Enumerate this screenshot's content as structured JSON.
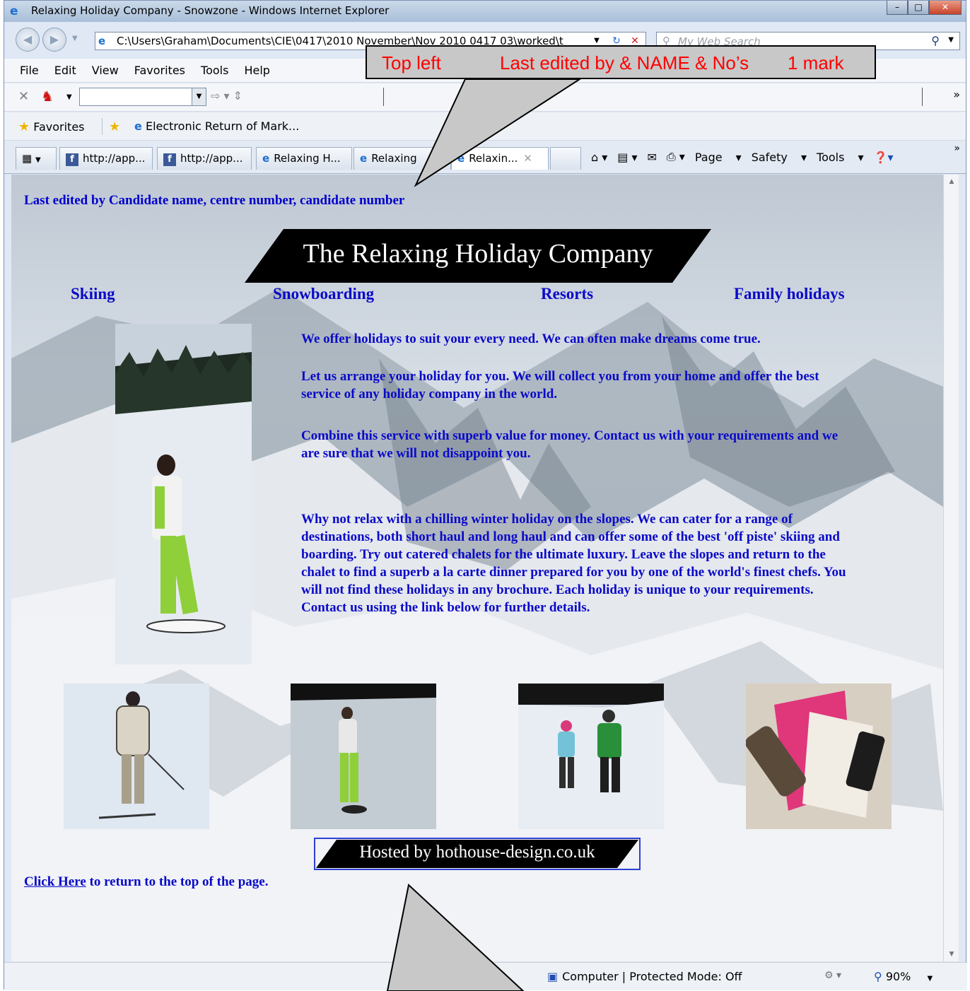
{
  "window": {
    "title": "Relaxing Holiday Company - Snowzone - Windows Internet Explorer",
    "address": "C:\\Users\\Graham\\Documents\\CIE\\0417\\2010 November\\Nov 2010 0417 03\\worked\\t",
    "search_placeholder": "My Web Search"
  },
  "menu": [
    "File",
    "Edit",
    "View",
    "Favorites",
    "Tools",
    "Help"
  ],
  "favorites": {
    "label": "Favorites",
    "item": "Electronic Return of Mark..."
  },
  "tabs": [
    {
      "label": "http://app...",
      "icon": "facebook-icon"
    },
    {
      "label": "http://app...",
      "icon": "facebook-icon"
    },
    {
      "label": "Relaxing H...",
      "icon": "ie-icon"
    },
    {
      "label": "Relaxing",
      "icon": "ie-icon"
    },
    {
      "label": "Relaxin...",
      "icon": "ie-icon"
    }
  ],
  "commands": {
    "page": "Page",
    "safety": "Safety",
    "tools": "Tools"
  },
  "page": {
    "edited": "Last edited by Candidate name, centre number, candidate number",
    "title": "The Relaxing Holiday Company",
    "nav": [
      "Skiing",
      "Snowboarding",
      "Resorts",
      "Family holidays"
    ],
    "paragraphs": [
      "We offer holidays to suit your every need. We can often make dreams come true.",
      "Let us arrange your holiday for you. We will collect you from your home and offer the best service of any holiday company in the world.",
      "Combine this service with superb value for money. Contact us with your requirements and we are sure that we will not disappoint you.",
      "Why not relax with a chilling winter holiday on the slopes. We can cater for a range of destinations, both short haul and long haul and can offer some of the best 'off piste' skiing and boarding. Try out catered chalets for the ultimate luxury. Leave the slopes and return to the chalet to find a superb a la carte dinner prepared for you by one of the world's finest chefs. You will not find these holidays in any brochure. Each holiday is unique to your requirements. Contact us using the link below for further details."
    ],
    "hosted": "Hosted by hothouse-design.co.uk",
    "click_here": "Click Here",
    "return_text": " to return to the top of the page."
  },
  "status": {
    "zone": "Computer | Protected Mode: Off",
    "zoom": "90%"
  },
  "annotation": {
    "pos": "Top left",
    "what": "Last edited by & NAME & No’s",
    "mark": "1 mark"
  },
  "colors": {
    "link_blue": "#0a0ac8",
    "annotation_red": "#ff0000"
  }
}
